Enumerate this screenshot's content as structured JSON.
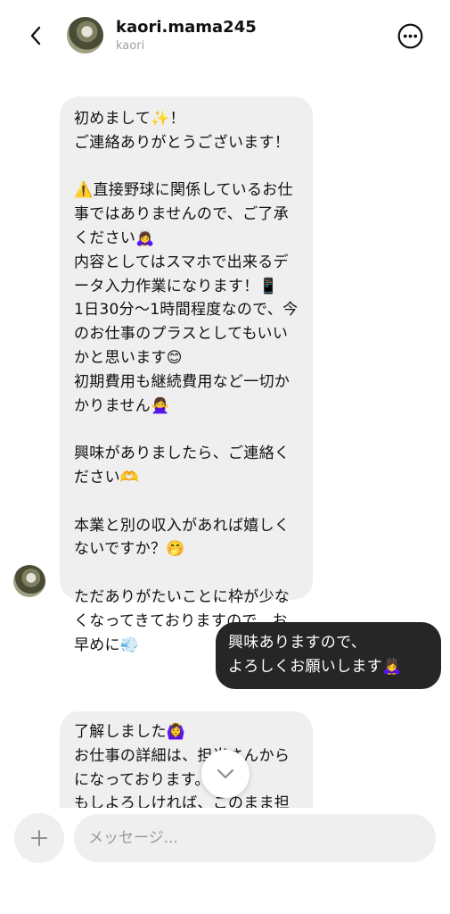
{
  "header": {
    "username": "kaori.mama245",
    "subname": "kaori",
    "back_icon": "chevron-left-icon",
    "more_icon": "more-horizontal-circle-icon"
  },
  "messages": [
    {
      "direction": "received",
      "text": "初めまして✨！\nご連絡ありがとうございます！\n\n⚠️直接野球に関係しているお仕事ではありませんので、ご了承ください🙇‍♀️\n内容としてはスマホで出来るデータ入力作業になります！📱\n1日30分〜1時間程度なので、今のお仕事のプラスとしてもいいかと思います😊\n初期費用も継続費用など一切かかりません🙅‍♀️\n\n興味がありましたら、ご連絡ください🫶\n\n本業と別の収入があれば嬉しくないですか？🤭\n\nただありがたいことに枠が少なくなってきておりますので、お早めに💨"
    },
    {
      "direction": "sent",
      "text": "興味ありますので、\nよろしくお願いします🙇‍♀️"
    },
    {
      "direction": "received",
      "text": "了解しました🙆‍♀️\nお仕事の詳細は、担当さんからになっております。✨\nもしよろしければ、このまま担当さ"
    }
  ],
  "composer": {
    "placeholder": "メッセージ...",
    "plus_icon": "plus-icon"
  },
  "scroll_button_icon": "chevron-down-icon"
}
